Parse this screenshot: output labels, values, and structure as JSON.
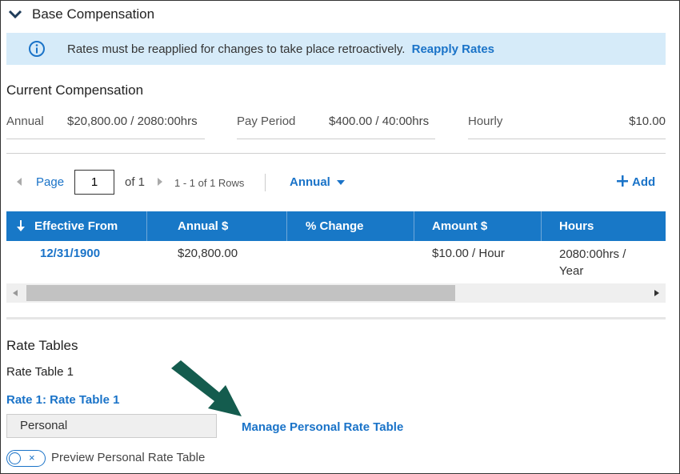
{
  "section": {
    "title": "Base Compensation",
    "icon": "chevron-down-icon"
  },
  "banner": {
    "icon": "info-icon",
    "message": "Rates must be reapplied for changes to take place retroactively.",
    "link": "Reapply Rates",
    "background": "#d6ebf9"
  },
  "current": {
    "title": "Current Compensation",
    "annual_label": "Annual",
    "annual_value": "$20,800.00 / 2080:00hrs",
    "pay_period_label": "Pay Period",
    "pay_period_value": "$400.00 / 40:00hrs",
    "hourly_label": "Hourly",
    "hourly_value": "$10.00"
  },
  "pager": {
    "page_label": "Page",
    "page_value": "1",
    "of_label": "of 1",
    "rows_label": "1 - 1 of 1 Rows",
    "view_label": "Annual",
    "add_label": "Add"
  },
  "table": {
    "header_color": "#1878c7",
    "columns": [
      "Effective From",
      "Annual $",
      "% Change",
      "Amount $",
      "Hours"
    ],
    "rows": [
      {
        "effective_from": "12/31/1900",
        "annual": "$20,800.00",
        "change": "",
        "amount": "$10.00 / Hour",
        "hours_line1": "2080:00hrs /",
        "hours_line2": "Year"
      }
    ]
  },
  "rate_tables": {
    "title": "Rate Tables",
    "subtitle": "Rate Table 1",
    "rate_link": "Rate 1: Rate Table 1",
    "select_value": "Personal",
    "manage_link": "Manage Personal Rate Table",
    "toggle_label": "Preview Personal Rate Table",
    "toggle_x": "×"
  },
  "accent": "#1a73c8"
}
